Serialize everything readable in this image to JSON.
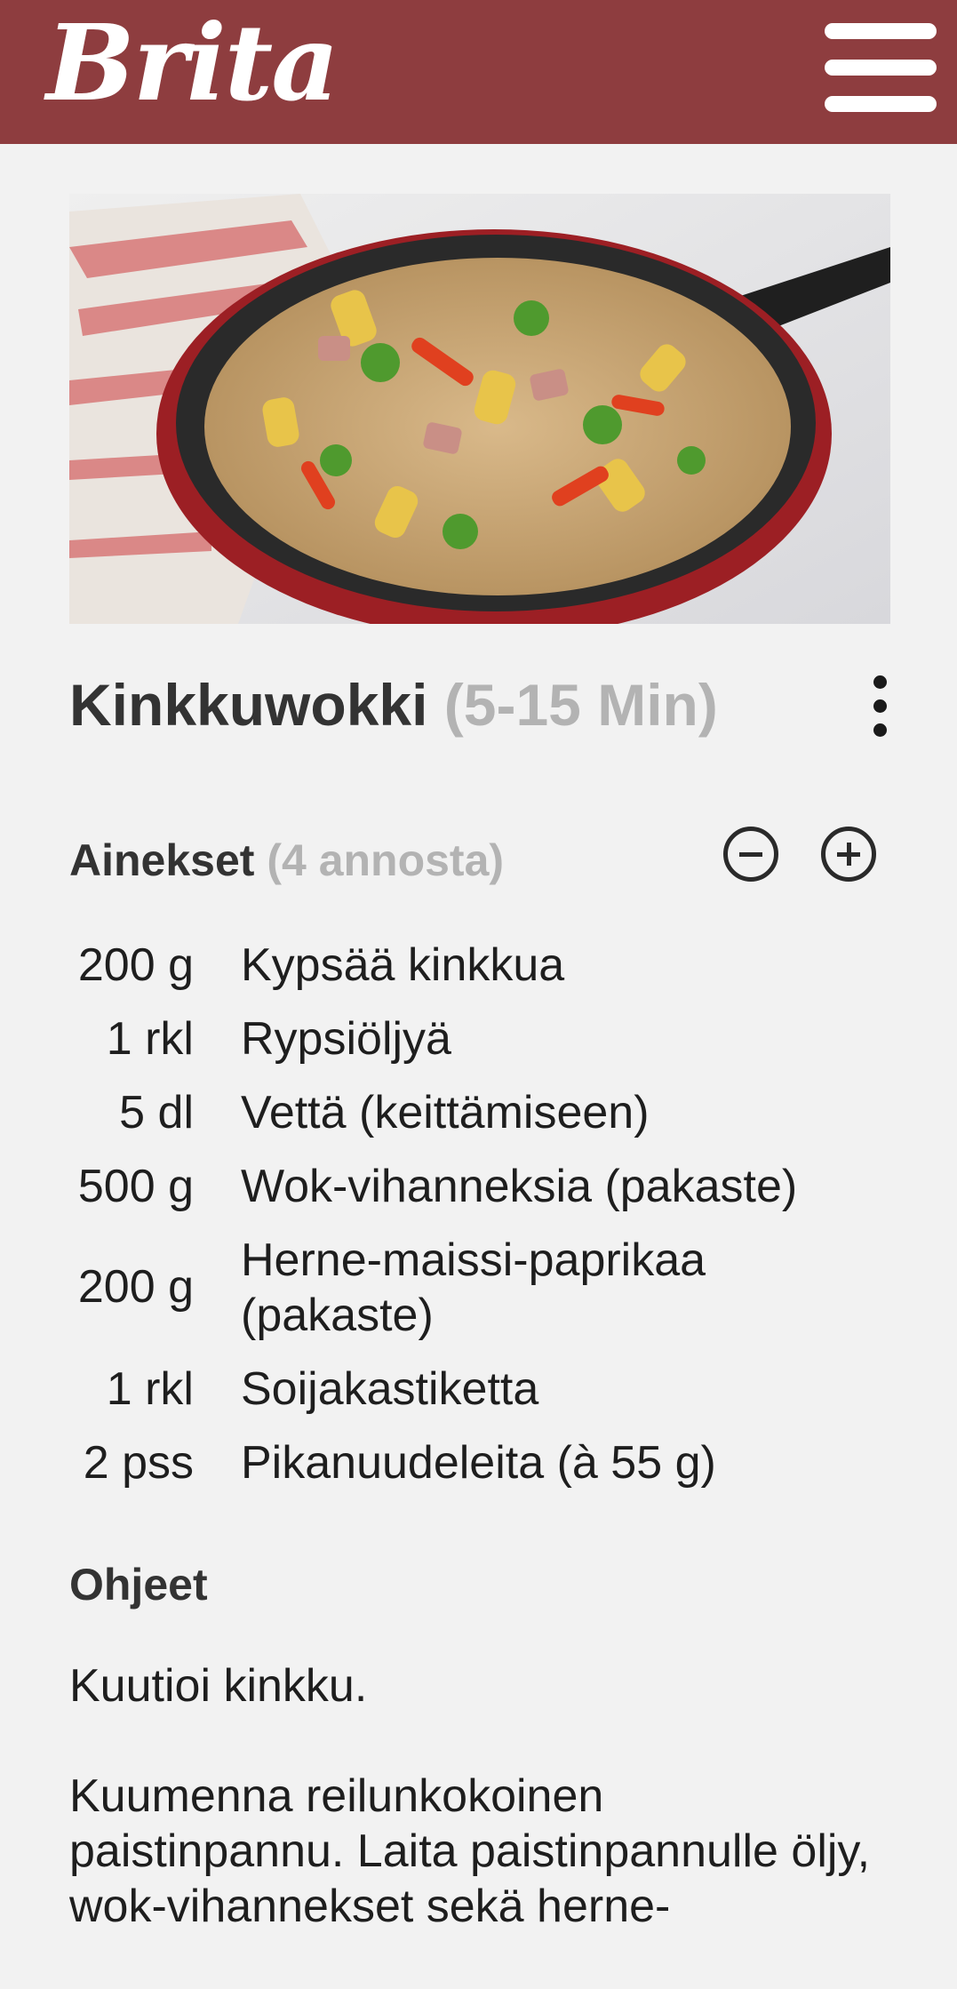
{
  "header": {
    "logo_text": "Brita",
    "menu_icon": "hamburger-menu-icon"
  },
  "hero": {
    "image_alt": "Kinkkuwokki"
  },
  "recipe": {
    "title": "Kinkkuwokki",
    "time": "(5-15 Min)",
    "more_icon": "more-vertical-icon"
  },
  "ingredients": {
    "heading": "Ainekset",
    "servings": "(4 annosta)",
    "decrease_icon": "minus-circle-icon",
    "increase_icon": "plus-circle-icon",
    "items": [
      {
        "qty": "200 g",
        "name": "Kypsää kinkkua"
      },
      {
        "qty": "1 rkl",
        "name": "Rypsiöljyä"
      },
      {
        "qty": "5 dl",
        "name": "Vettä (keittämiseen)"
      },
      {
        "qty": "500 g",
        "name": "Wok-vihanneksia (pakaste)"
      },
      {
        "qty": "200 g",
        "name": "Herne-maissi-paprikaa (pakaste)"
      },
      {
        "qty": "1 rkl",
        "name": "Soijakastiketta"
      },
      {
        "qty": "2 pss",
        "name": "Pikanuudeleita (à 55 g)"
      }
    ]
  },
  "instructions": {
    "heading": "Ohjeet",
    "steps": [
      "Kuutioi kinkku.",
      "Kuumenna reilunkokoinen paistinpannu. Laita paistinpannulle öljy, wok-vihannekset sekä herne-"
    ]
  }
}
